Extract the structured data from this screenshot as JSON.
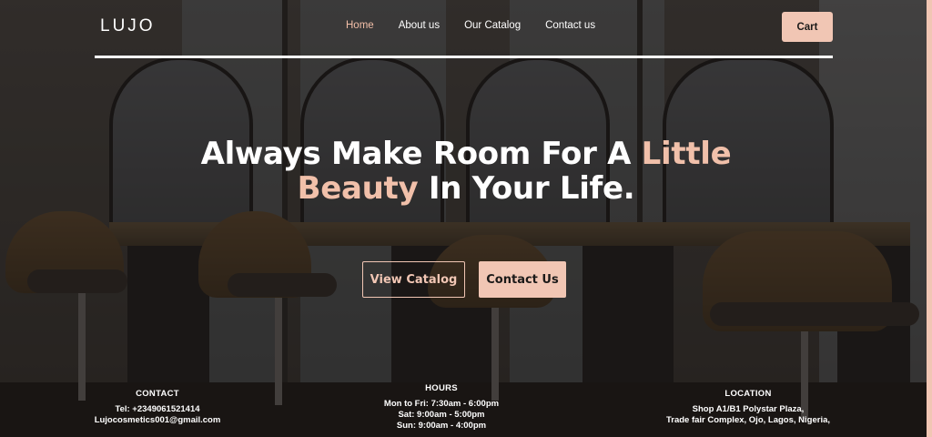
{
  "brand": {
    "logo": "LUJO"
  },
  "nav": {
    "items": [
      {
        "label": "Home",
        "active": true
      },
      {
        "label": "About us",
        "active": false
      },
      {
        "label": "Our Catalog",
        "active": false
      },
      {
        "label": "Contact us",
        "active": false
      }
    ],
    "cart_label": "Cart"
  },
  "hero": {
    "line1_prefix": "Always Make Room For A ",
    "line1_accent": "Little",
    "line2_accent": "Beauty",
    "line2_suffix": " In Your Life.",
    "primary_button": "View Catalog",
    "secondary_button": "Contact Us"
  },
  "contact": {
    "heading": "CONTACT",
    "phone": "Tel: +2349061521414",
    "email": "Lujocosmetics001@gmail.com"
  },
  "hours": {
    "heading": "HOURS",
    "weekday": "Mon to Fri: 7:30am - 6:00pm",
    "saturday": "Sat: 9:00am - 5:00pm",
    "sunday": "Sun: 9:00am - 4:00pm"
  },
  "location": {
    "heading": "LOCATION",
    "line1": "Shop A1/B1 Polystar Plaza,",
    "line2": "Trade fair Complex, Ojo, Lagos, Nigeria,"
  },
  "colors": {
    "accent": "#f1c6b4",
    "active_nav": "#f3bfa8",
    "button_text": "#1c1a19"
  }
}
